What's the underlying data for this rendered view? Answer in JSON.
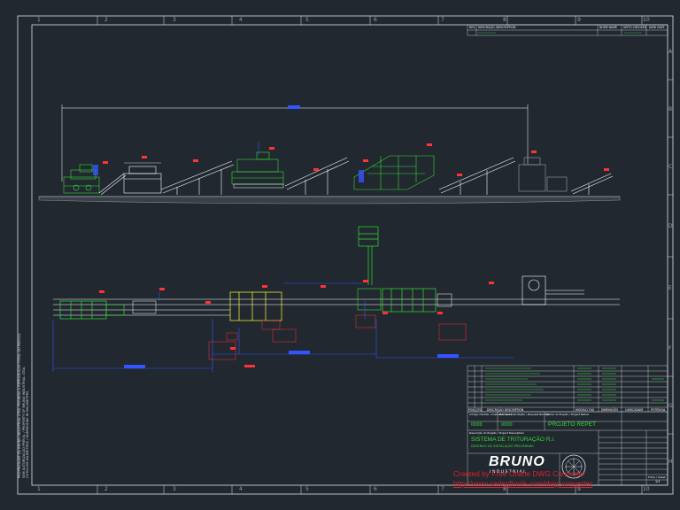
{
  "drawing": {
    "frame_columns": [
      "1",
      "2",
      "3",
      "4",
      "5",
      "6",
      "7",
      "8",
      "9",
      "10"
    ],
    "frame_rows": [
      "A",
      "B",
      "C",
      "D",
      "E",
      "F",
      "G",
      "H"
    ],
    "colors": {
      "background": "#212830",
      "frame": "#dfe3e6",
      "equipment": "#33dd33",
      "conveyor": "#ffffff",
      "dimension": "#3355ff",
      "callout": "#ff3333",
      "ground": "#8a8f94"
    }
  },
  "revision_table": {
    "headers": [
      "REV.",
      "DESCRIÇÃO /DESCRIPTION",
      "NOME NAME",
      "VISTO CHECKED",
      "DATA DATE"
    ]
  },
  "parts_list": {
    "headers": [
      "POS.",
      "QTD.",
      "DESCRIÇÃO DESCRIPTION",
      "MODELO TAG",
      "DIMENSÕES",
      "CAPACIDADE",
      "POTÊNCIA"
    ]
  },
  "title_block": {
    "codes": {
      "code_label": "Código Cliente / Customer Code",
      "code_value": "0000",
      "number_label": "Número Solicitação / Request Number",
      "number_value": "0000"
    },
    "project_label": "Nome do Projeto / Project Name",
    "project_name": "PROJETO REPET",
    "title_label": "Descrição do Projeto / Project Description",
    "system_title": "SISTEMA DE TRITURAÇÃO R.I.",
    "subtitle": "DESENHO DE INSTALAÇÃO PRELIMINAR",
    "company": "BRUNO",
    "company_sub": "I N D U S T R I A L",
    "sheet_label": "Folha / Sheet",
    "sheet_value": "1/1"
  },
  "side_note": {
    "line1": "PROPRIEDADE DA BRUNO INDUSTRIAL LTDA. PROIBIDA A REPRODUÇÃO TOTAL OU PARCIAL",
    "line2": "SEM AUTORIZAÇÃO PRÉVIA. / PROPERTY OF BRUNO INDUSTRIAL LTDA.",
    "line3": "COTAS EM MILÍMETROS / DIMENSIONS IN MILLIMETERS"
  },
  "watermark": {
    "line1": "Created by Free Online DWG Converter",
    "line2": "http://www.cadsoftools.com/dwg-converter"
  }
}
